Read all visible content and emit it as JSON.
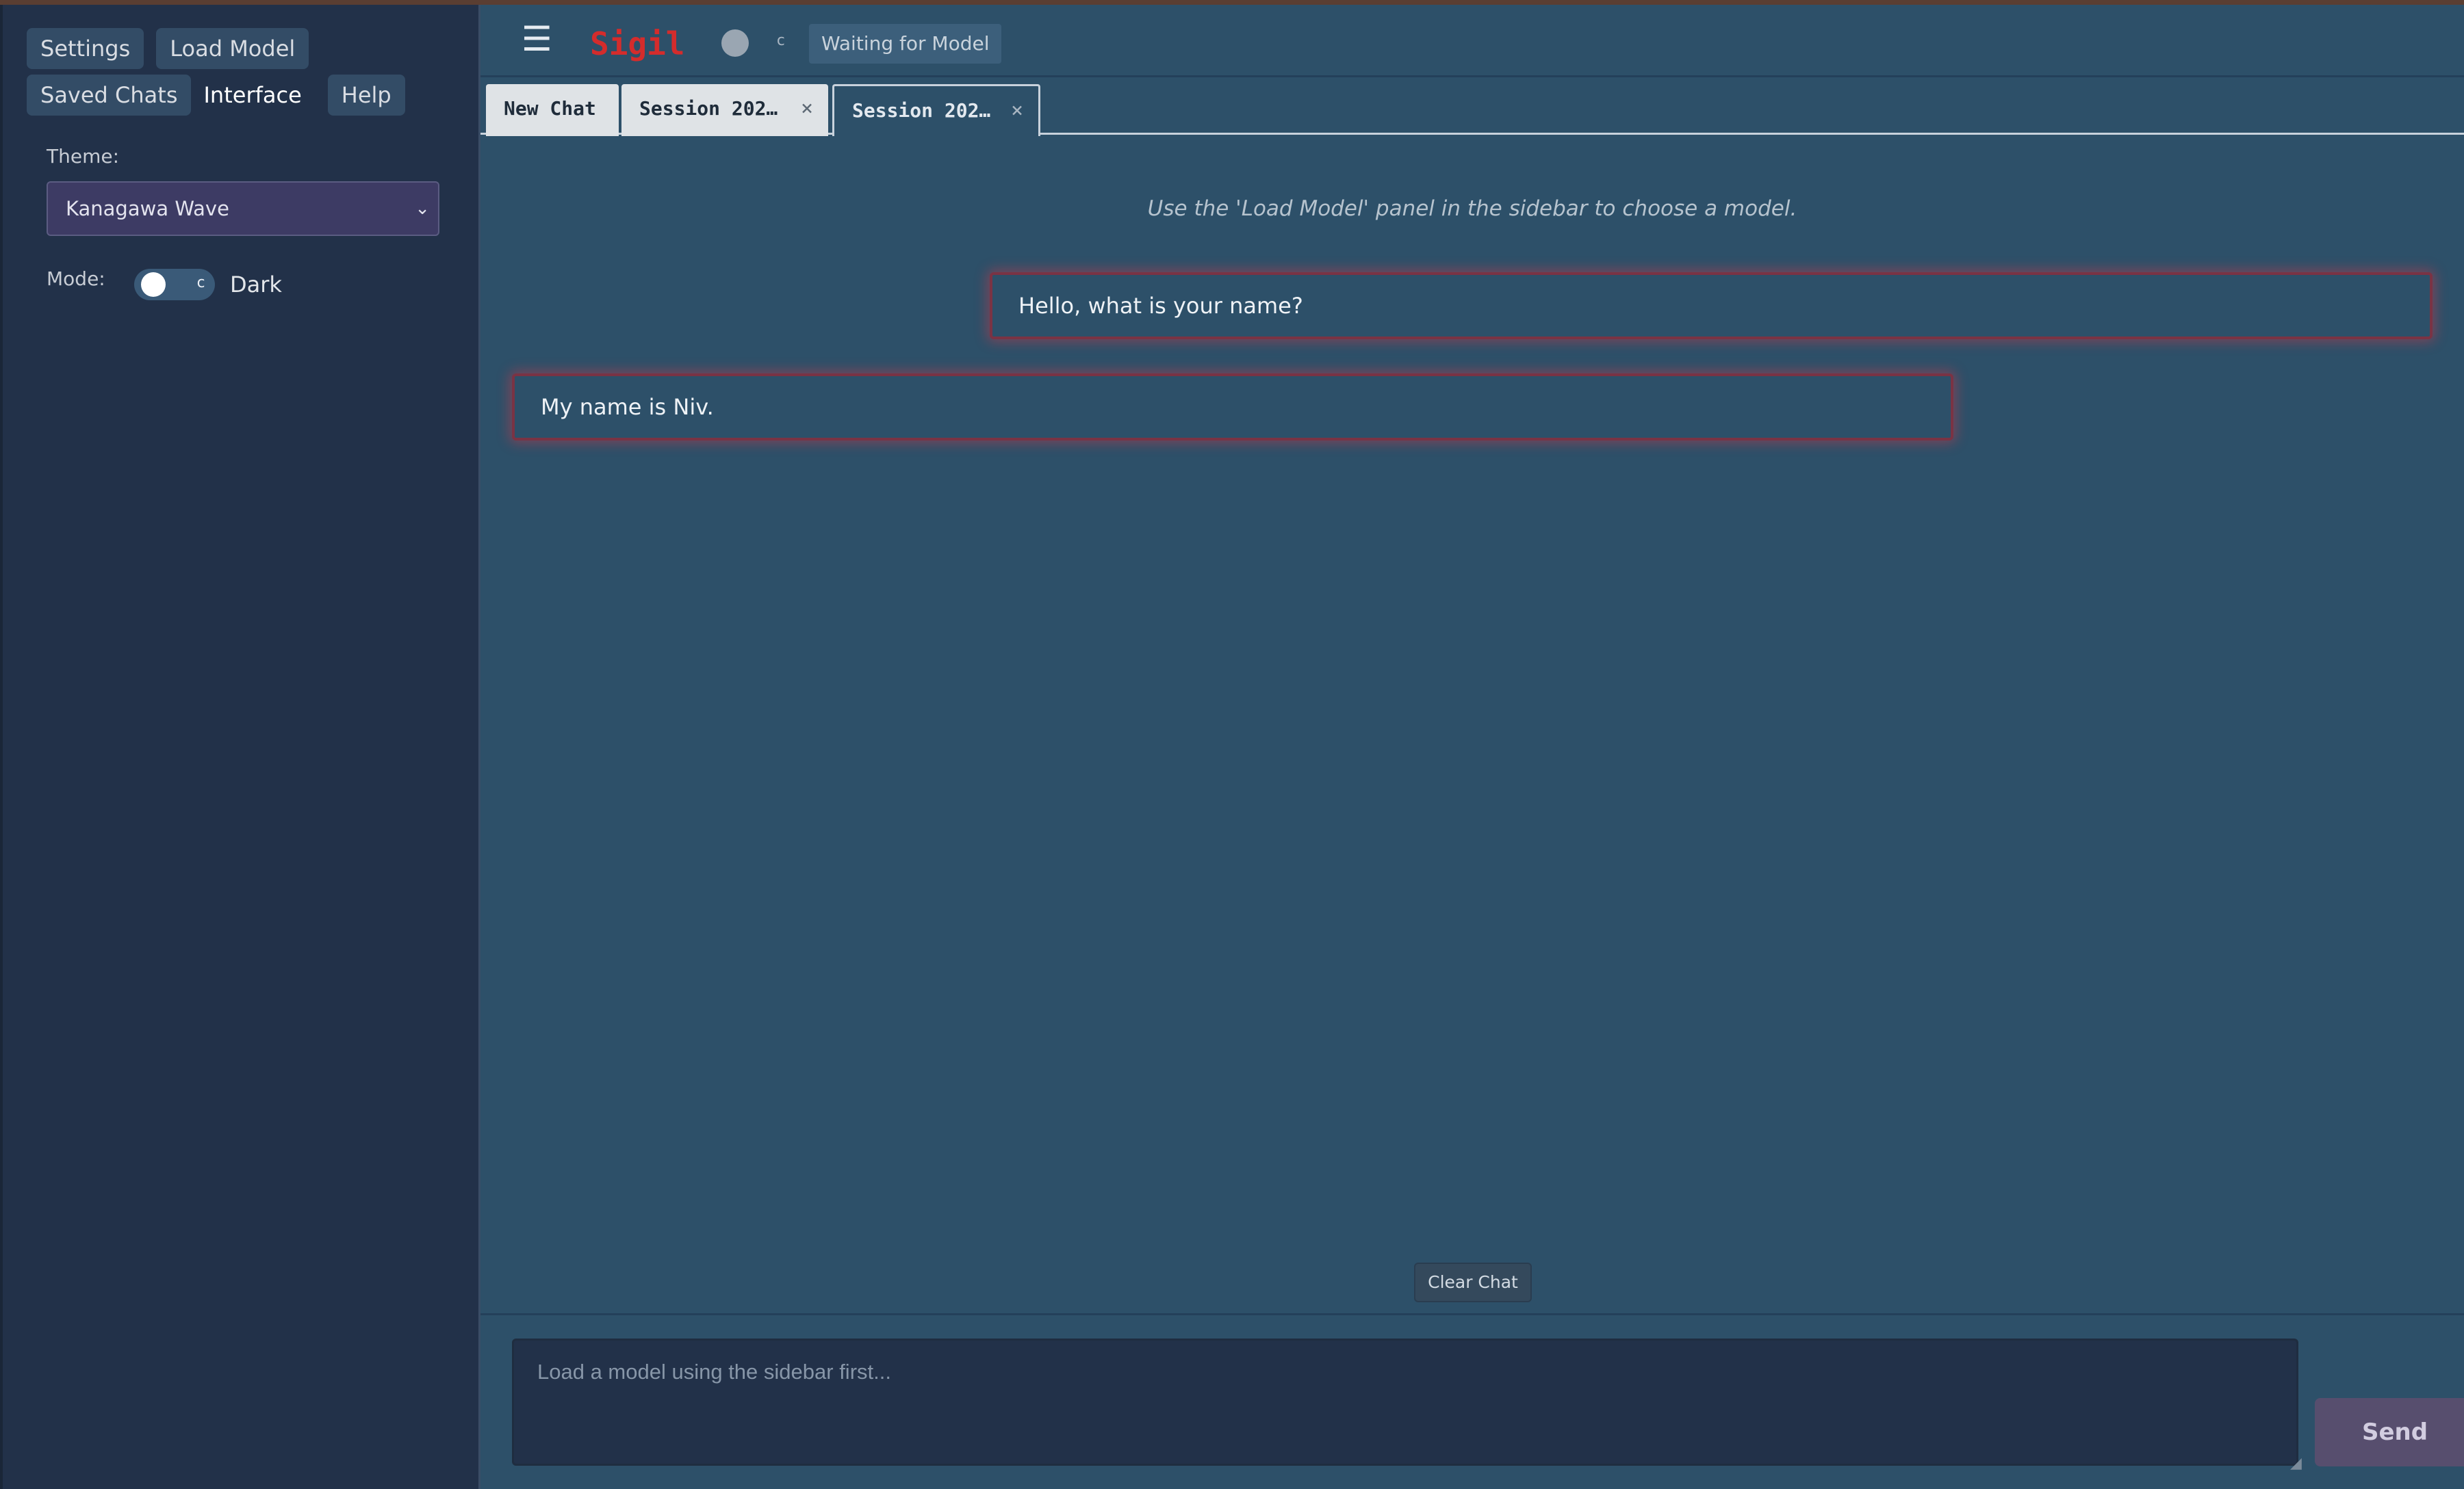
{
  "sidebar": {
    "tabs": [
      {
        "label": "Settings"
      },
      {
        "label": "Load Model"
      },
      {
        "label": "Saved Chats"
      },
      {
        "label": "Interface"
      },
      {
        "label": "Help"
      }
    ],
    "theme": {
      "label": "Theme:",
      "selected": "Kanagawa Wave"
    },
    "mode": {
      "label": "Mode:",
      "toggle_glyph": "c",
      "value": "Dark"
    }
  },
  "header": {
    "menu_glyph": "☰",
    "app_title": "Sigil",
    "status_glyph": "c",
    "status_text": "Waiting for Model"
  },
  "chat_tabs": [
    {
      "label": "New Chat"
    },
    {
      "label": "Session 202…",
      "close": "×"
    },
    {
      "label": "Session 202…",
      "close": "×"
    }
  ],
  "chat": {
    "hint": "Use the 'Load Model' panel in the sidebar to choose a model.",
    "messages": [
      {
        "role": "user",
        "text": "Hello, what is your name?"
      },
      {
        "role": "assistant",
        "text": "My name is Niv."
      }
    ],
    "clear_label": "Clear Chat"
  },
  "composer": {
    "placeholder": "Load a model using the sidebar first...",
    "send_label": "Send"
  },
  "colors": {
    "sidebar_bg": "#223149",
    "main_bg": "#2d5069",
    "title_red": "#d42c2c",
    "bubble_glow": "#d63746"
  }
}
